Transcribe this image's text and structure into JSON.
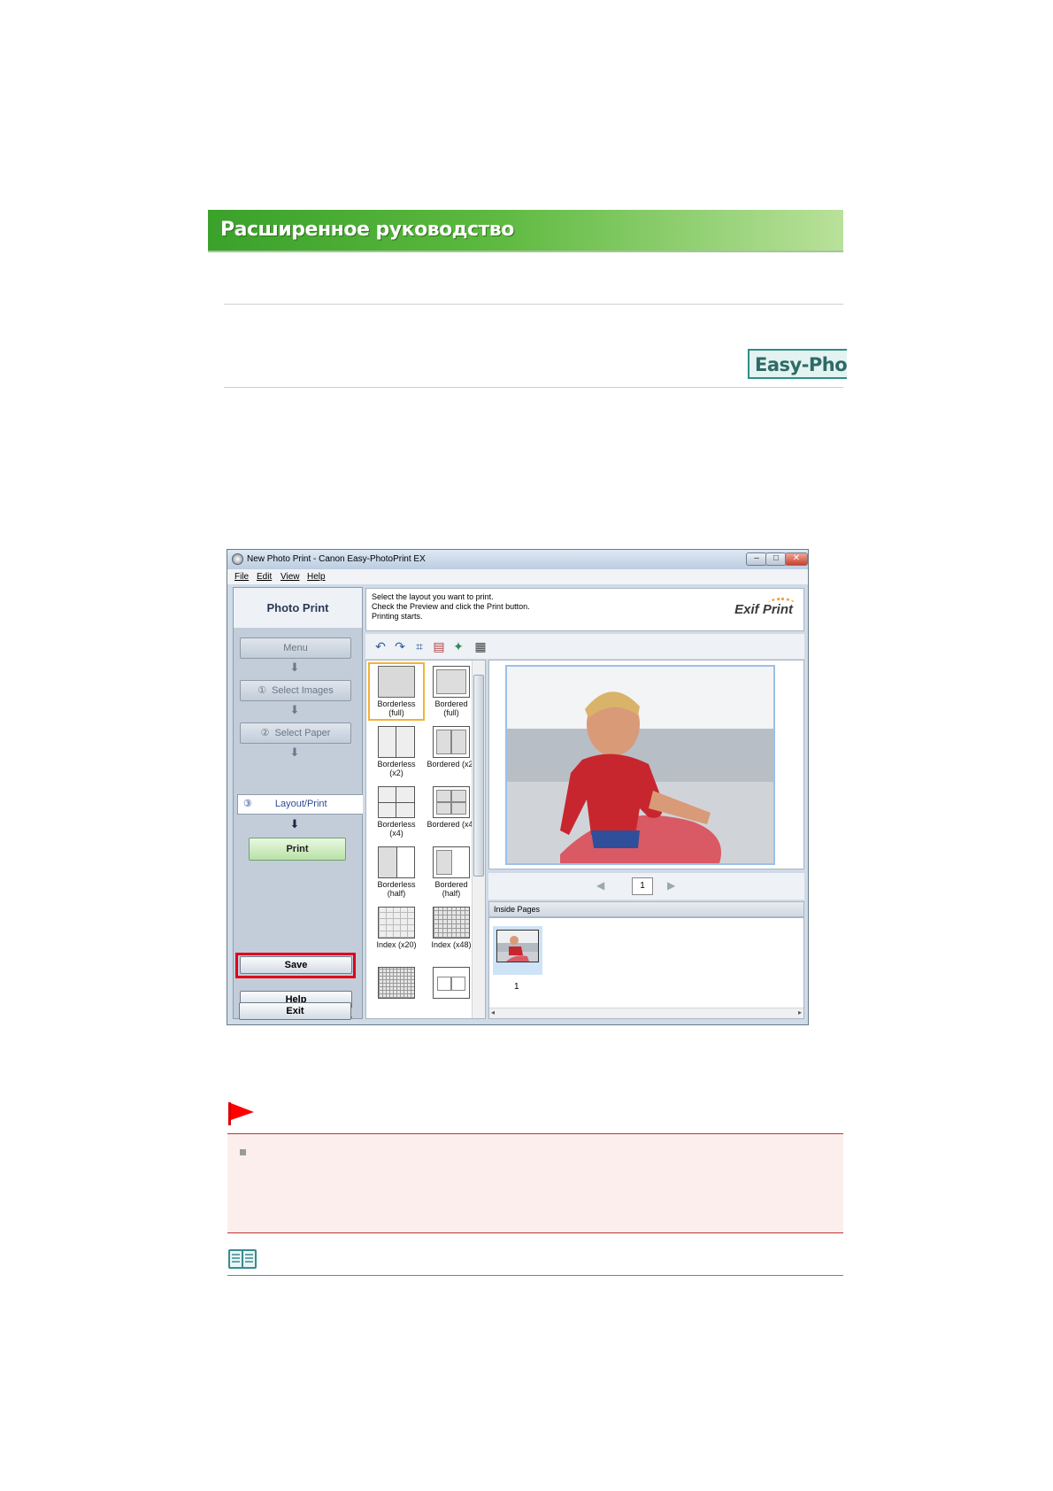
{
  "banner": {
    "title": "Расширенное руководство"
  },
  "logo": {
    "text": "Easy-PhotoPrint EX"
  },
  "window": {
    "title": "New Photo Print - Canon Easy-PhotoPrint EX",
    "controls": {
      "minimize": "–",
      "maximize": "□",
      "close": "✕"
    },
    "menu": [
      "File",
      "Edit",
      "View",
      "Help"
    ],
    "left_pane": {
      "title": "Photo Print",
      "menu_button": "Menu",
      "steps": [
        {
          "num": "①",
          "label": "Select Images"
        },
        {
          "num": "②",
          "label": "Select Paper"
        },
        {
          "num": "③",
          "label": "Layout/Print"
        }
      ],
      "print_button": "Print",
      "save_button": "Save",
      "help_button": "Help",
      "exit_button": "Exit"
    },
    "instructions": [
      "Select the layout you want to print.",
      "Check the Preview and click the Print button.",
      "Printing starts."
    ],
    "exif_logo": "Exif Print",
    "toolbar_icons": [
      "rotate-left-icon",
      "rotate-right-icon",
      "crop-icon",
      "image-correction-icon",
      "effects-icon",
      "add-text-icon"
    ],
    "layouts": [
      {
        "caption": "Borderless\n(full)",
        "selected": true
      },
      {
        "caption": "Bordered (full)"
      },
      {
        "caption": "Borderless\n(x2)"
      },
      {
        "caption": "Bordered (x2)"
      },
      {
        "caption": "Borderless\n(x4)"
      },
      {
        "caption": "Bordered (x4)"
      },
      {
        "caption": "Borderless\n(half)"
      },
      {
        "caption": "Bordered\n(half)"
      },
      {
        "caption": "Index (x20)"
      },
      {
        "caption": "Index (x48)"
      }
    ],
    "page_number": "1",
    "inside_pages_label": "Inside Pages",
    "thumbnail_number": "1",
    "colors": {
      "highlight": "#e0001a",
      "selected_outline": "#f2b237",
      "banner": "#3aa12a"
    }
  }
}
